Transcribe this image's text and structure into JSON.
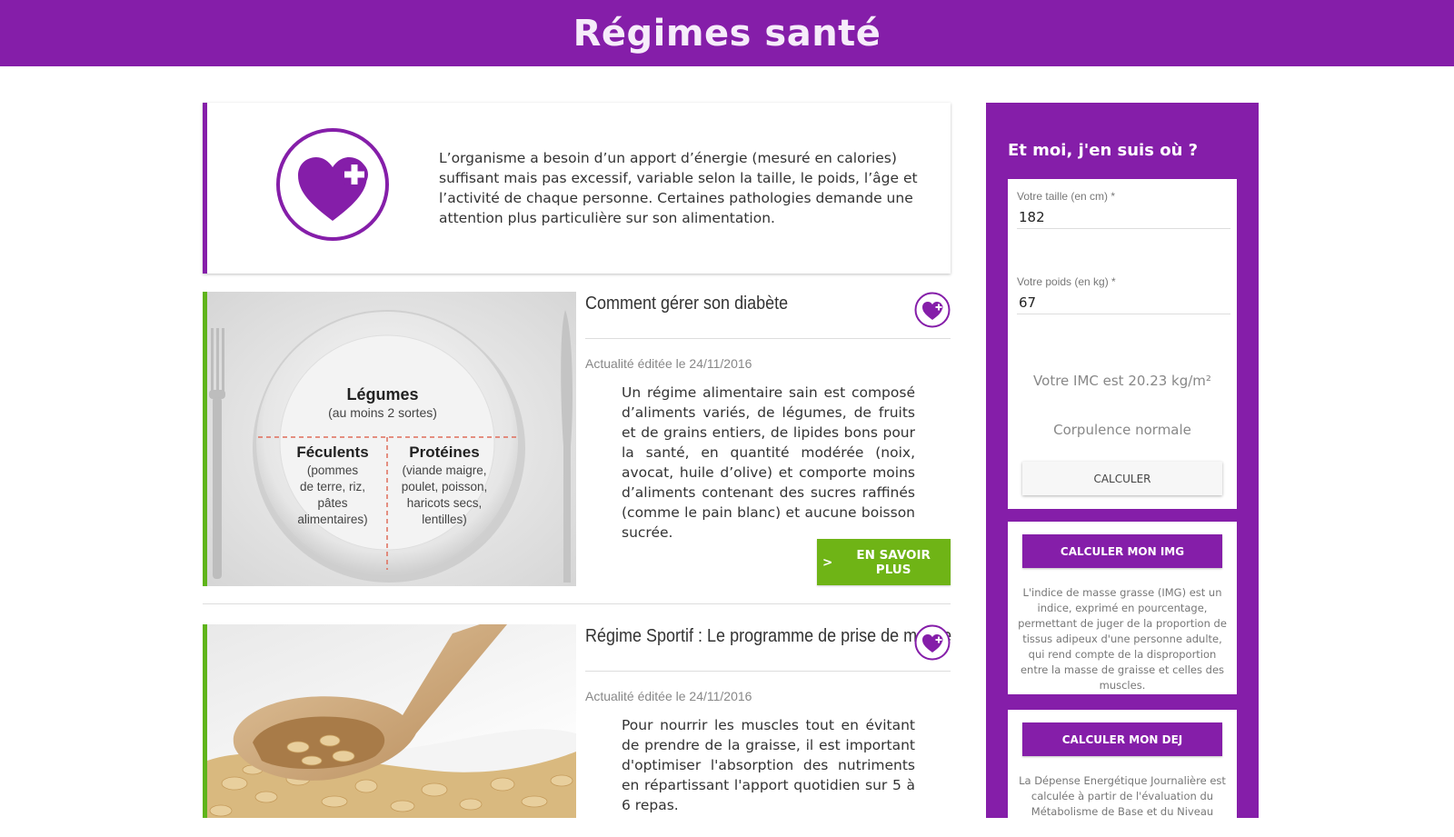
{
  "header": {
    "title": "Régimes santé"
  },
  "intro": {
    "icon": "heart-plus-icon",
    "text": "L’organisme a besoin d’un apport d’énergie (mesuré en calories) suffisant mais pas excessif, variable selon la taille, le poids, l’âge et l’activité de chaque personne. Certaines pathologies demande une attention plus particulière sur son alimentation."
  },
  "articles": [
    {
      "title": "Comment gérer son diabète",
      "date": "Actualité éditée le 24/11/2016",
      "body": "Un régime alimentaire sain est composé d’aliments variés, de légumes, de fruits et de grains entiers, de lipides bons pour la santé, en quantité modérée (noix, avocat, huile d’olive) et comporte moins d’aliments contenant des sucres raffinés (comme le pain blanc) et aucune boisson sucrée.",
      "more_label": "EN SAVOIR PLUS",
      "more_arrow": ">",
      "image": {
        "legumes": "Légumes",
        "legumes_sub": "(au moins 2 sortes)",
        "feculents": "Féculents",
        "feculents_sub": [
          "(pommes",
          "de terre, riz,",
          "pâtes",
          "alimentaires)"
        ],
        "proteines": "Protéines",
        "proteines_sub": [
          "(viande maigre,",
          "poulet, poisson,",
          "haricots secs,",
          "lentilles)"
        ]
      }
    },
    {
      "title": "Régime Sportif : Le programme de prise de masse",
      "date": "Actualité éditée le 24/11/2016",
      "body": "Pour nourrir les muscles tout en évitant de prendre de la graisse, il est important d'optimiser l'absorption des nutriments en répartissant l'apport quotidien sur 5 à 6 repas."
    }
  ],
  "sidebar": {
    "title": "Et moi, j'en suis où ?",
    "height_label": "Votre taille (en cm) *",
    "height_value": "182",
    "weight_label": "Votre poids (en kg) *",
    "weight_value": "67",
    "imc_result": "Votre IMC est 20.23 kg/m²",
    "corpulence": "Corpulence normale",
    "calc_label": "CALCULER",
    "img_button": "CALCULER MON IMG",
    "img_desc": "L'indice de masse grasse (IMG) est un indice, exprimé en pourcentage, permettant de juger de la proportion de tissus adipeux d'une personne adulte, qui rend compte de la disproportion entre la masse de graisse et celles des muscles.",
    "dej_button": "CALCULER MON DEJ",
    "dej_desc": "La Dépense Energétique Journalière est calculée à partir de l'évaluation du Métabolisme de Base et du Niveau"
  },
  "colors": {
    "brand": "#851ea9",
    "accent_green": "#6fb416",
    "border_green": "#5fb41a"
  }
}
